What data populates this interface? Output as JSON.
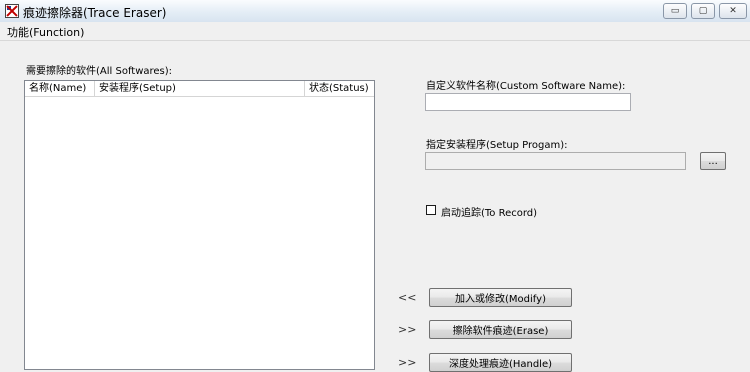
{
  "window": {
    "title": "痕迹擦除器(Trace Eraser)",
    "controls": {
      "minimize": "▭",
      "restore": "▢",
      "close": "✕"
    }
  },
  "menu": {
    "function": "功能(Function)"
  },
  "left": {
    "list_label": "需要擦除的软件(All Softwares):",
    "columns": [
      "名称(Name)",
      "安装程序(Setup)",
      "状态(Status)"
    ]
  },
  "right": {
    "custom_name_label": "自定义软件名称(Custom Software Name):",
    "custom_name_value": "",
    "setup_label": "指定安装程序(Setup Progam):",
    "setup_value": "",
    "browse_label": "...",
    "record_label": "启动追踪(To Record)",
    "record_checked": false
  },
  "actions": [
    {
      "arrow": "<<",
      "label": "加入或修改(Modify)"
    },
    {
      "arrow": ">>",
      "label": "擦除软件痕迹(Erase)"
    },
    {
      "arrow": ">>",
      "label": "深度处理痕迹(Handle)"
    }
  ]
}
